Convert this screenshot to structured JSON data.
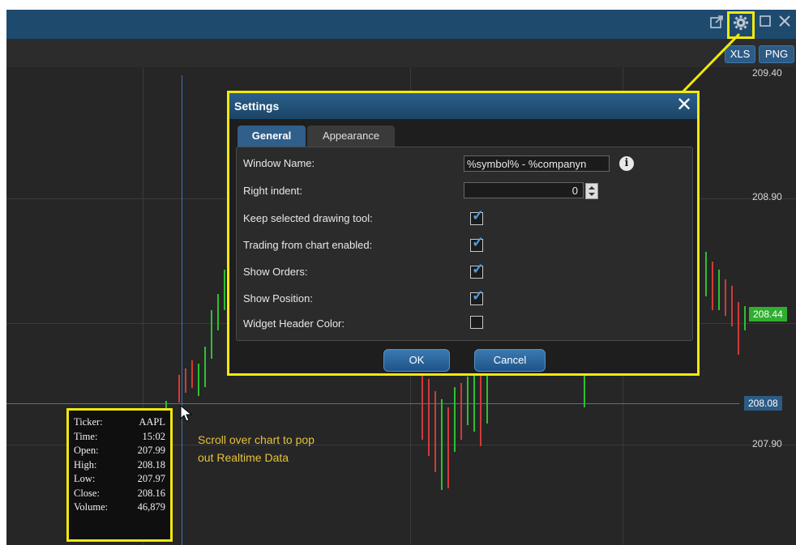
{
  "titlebar": {
    "icons": [
      "popout-icon",
      "gear-icon",
      "maximize-icon",
      "close-icon"
    ]
  },
  "toolbar": {
    "xls_label": "XLS",
    "png_label": "PNG"
  },
  "price_axis": {
    "labels": [
      "209.40",
      "208.90",
      "207.90"
    ],
    "last_price": "208.44",
    "crosshair_price": "208.08"
  },
  "settings_dialog": {
    "title": "Settings",
    "tabs": [
      "General",
      "Appearance"
    ],
    "active_tab": "General",
    "window_name_label": "Window Name:",
    "window_name_value": "%symbol% - %companyn",
    "right_indent_label": "Right indent:",
    "right_indent_value": "0",
    "checkboxes": [
      {
        "label": "Keep selected drawing tool:",
        "checked": true
      },
      {
        "label": "Trading from chart enabled:",
        "checked": true
      },
      {
        "label": "Show Orders:",
        "checked": true
      },
      {
        "label": "Show Position:",
        "checked": true
      },
      {
        "label": "Widget Header Color:",
        "checked": false
      }
    ],
    "ok_label": "OK",
    "cancel_label": "Cancel"
  },
  "data_popup": {
    "rows": [
      {
        "key": "Ticker:",
        "value": "AAPL"
      },
      {
        "key": "Time:",
        "value": "15:02"
      },
      {
        "key": "Open:",
        "value": "207.99"
      },
      {
        "key": "High:",
        "value": "208.18"
      },
      {
        "key": "Low:",
        "value": "207.97"
      },
      {
        "key": "Close:",
        "value": "208.16"
      },
      {
        "key": "Volume:",
        "value": "46,879"
      }
    ]
  },
  "annotation": {
    "line1": "Scroll over chart to pop",
    "line2": "out Realtime Data"
  },
  "colors": {
    "titlebar": "#1e4a6e",
    "highlight": "#f2e90c",
    "up_candle": "#2fbf2f",
    "down_candle": "#d23a3a",
    "annotation": "#e6c23a"
  }
}
